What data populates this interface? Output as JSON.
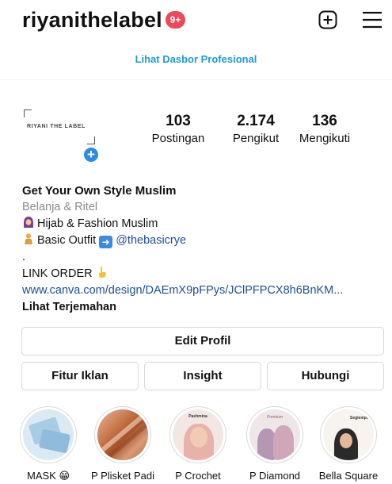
{
  "header": {
    "username": "riyanithelabel",
    "notification_badge": "9+",
    "badge_color": "#ed4956",
    "icons": [
      "new-post-icon",
      "menu-icon"
    ]
  },
  "dashboard_link": "Lihat Dasbor Profesional",
  "profile": {
    "avatar_text": "RIYANI THE LABEL",
    "avatar_add_symbol": "+",
    "stats": {
      "posts": {
        "value": "103",
        "label": "Postingan"
      },
      "followers": {
        "value": "2.174",
        "label": "Pengikut"
      },
      "following": {
        "value": "136",
        "label": "Mengikuti"
      }
    }
  },
  "bio": {
    "name": "Get Your Own Style Muslim",
    "category": "Belanja & Ritel",
    "line1": "Hijab & Fashion Muslim",
    "line2_prefix": "Basic Outfit",
    "line2_mention": "@thebasicrye",
    "dot": ".",
    "link_order": "LINK ORDER",
    "url": "www.canva.com/design/DAEmX9pFPys/JClPFPCX8h6BnKM...",
    "translate": "Lihat Terjemahan"
  },
  "buttons": {
    "edit_profile": "Edit Profil",
    "ads": "Fitur Iklan",
    "insight": "Insight",
    "contact": "Hubungi"
  },
  "highlights": [
    {
      "label": "MASK 😁"
    },
    {
      "label": "P Plisket Padi"
    },
    {
      "label": "P Crochet",
      "cover_text": "Pashmina"
    },
    {
      "label": "P Diamond",
      "cover_text": "Premium"
    },
    {
      "label": "Bella Square",
      "cover_text": "Segiempat"
    }
  ],
  "colors": {
    "link_blue": "#1d9bd8",
    "mention_blue": "#1d4f91",
    "add_button_blue": "#2b8ce6"
  }
}
